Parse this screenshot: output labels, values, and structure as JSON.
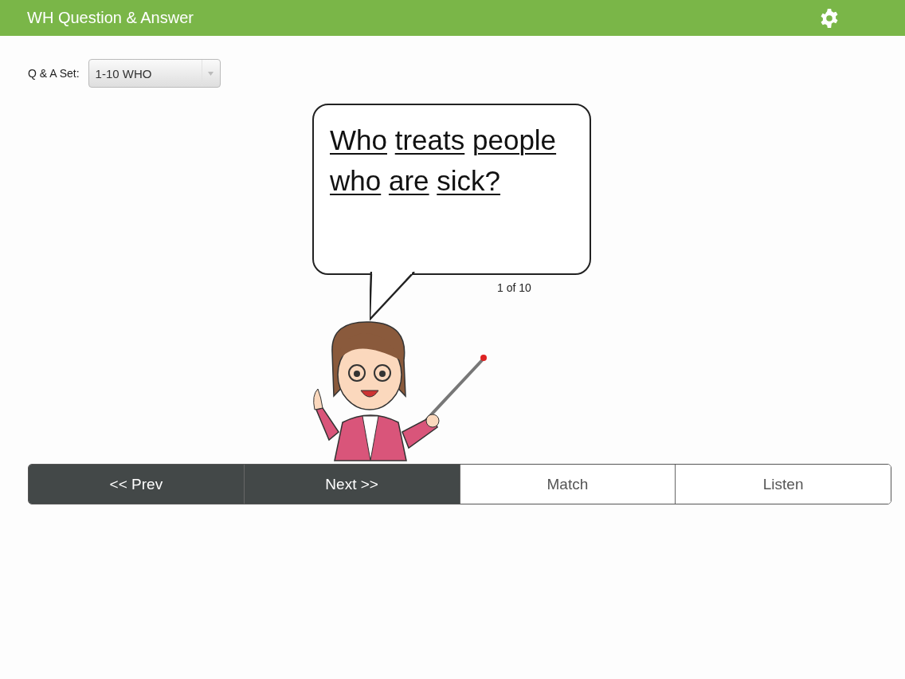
{
  "header": {
    "title": "WH Question & Answer"
  },
  "set_selector": {
    "label": "Q & A Set:",
    "value": "1-10 WHO"
  },
  "question": {
    "words": [
      "Who",
      "treats",
      "people",
      "who",
      "are",
      "sick?"
    ],
    "counter": "1 of 10"
  },
  "buttons": [
    {
      "label": "<< Prev",
      "kind": "dark"
    },
    {
      "label": "Next >>",
      "kind": "dark"
    },
    {
      "label": "Match",
      "kind": "light"
    },
    {
      "label": "Listen",
      "kind": "light"
    }
  ]
}
